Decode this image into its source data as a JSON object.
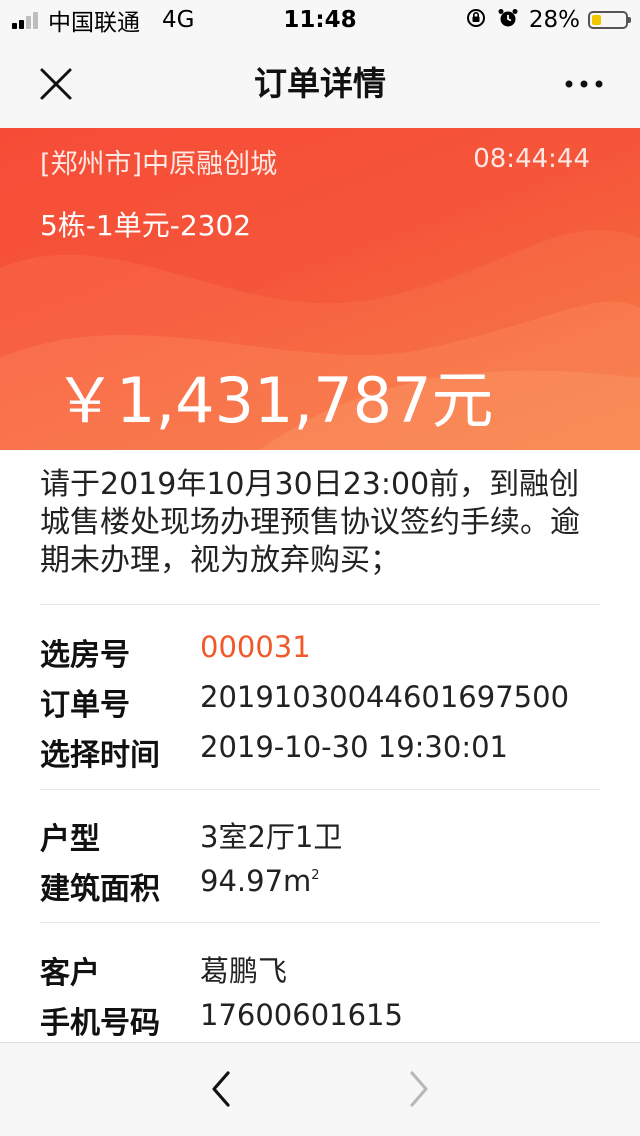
{
  "status_bar": {
    "carrier": "中国联通",
    "network": "4G",
    "time": "11:48",
    "battery_percent": "28%",
    "battery_level": 0.28,
    "battery_color": "#f2c600"
  },
  "nav": {
    "title": "订单详情",
    "close_icon": "close-icon",
    "more_icon": "more-icon"
  },
  "banner": {
    "location": "[郑州市]中原融创城",
    "time": "08:44:44",
    "unit": "5栋-1单元-2302",
    "price": "￥1,431,787元",
    "colors": {
      "start": "#f64c37",
      "end": "#f4773f"
    }
  },
  "notice": {
    "text": "请于2019年10月30日23:00前，到融创城售楼处现场办理预售协议签约手续。逾期未办理，视为放弃购买；"
  },
  "order_info": {
    "selection_number_label": "选房号",
    "selection_number_value": "000031",
    "order_number_label": "订单号",
    "order_number_value": "20191030044601697500",
    "select_time_label": "选择时间",
    "select_time_value": "2019-10-30 19:30:01",
    "accent_color": "#f1592a"
  },
  "house_info": {
    "layout_label": "户型",
    "layout_value": "3室2厅1卫",
    "area_label": "建筑面积",
    "area_value": "94.97m",
    "area_unit_sup": "2"
  },
  "customer_info": {
    "customer_label": "客户",
    "customer_value": "葛鹏飞",
    "phone_label": "手机号码",
    "phone_value": "17600601615"
  },
  "toolbar": {
    "back_icon": "chevron-left-icon",
    "forward_icon": "chevron-right-icon"
  }
}
